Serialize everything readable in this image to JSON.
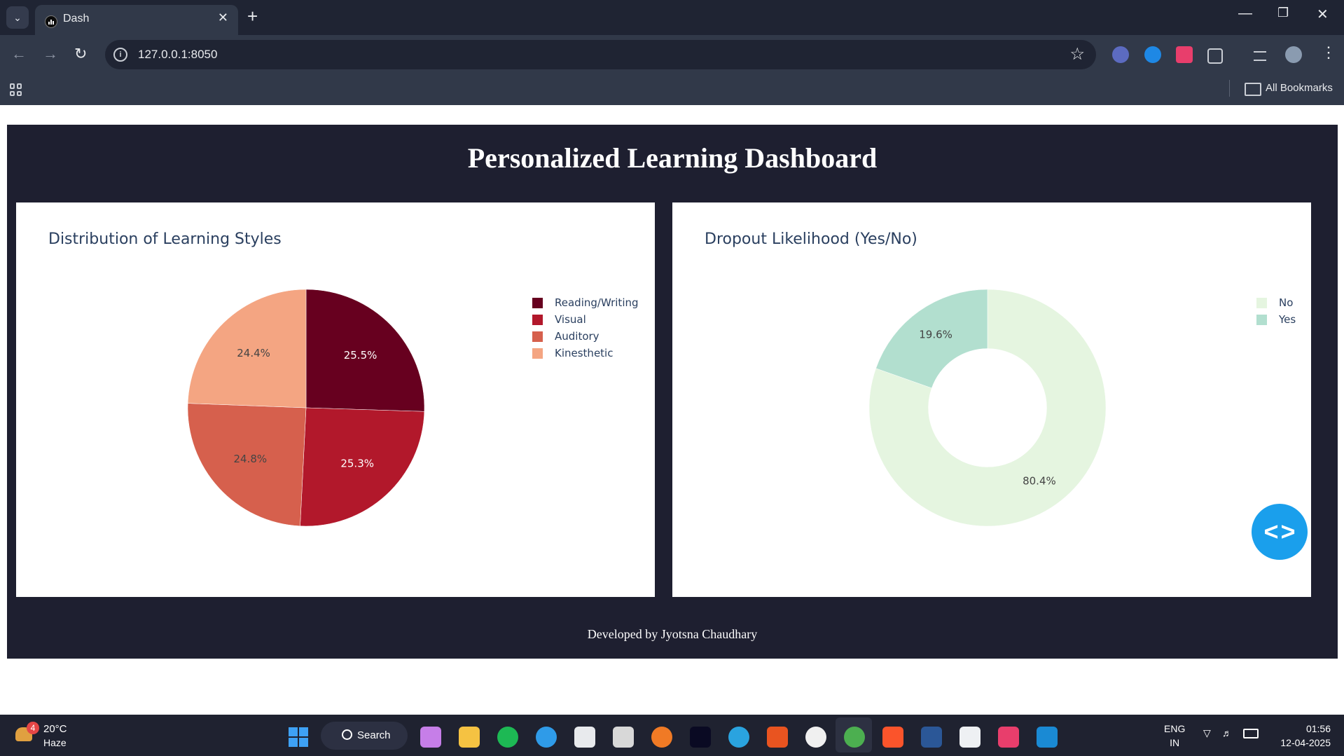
{
  "browser": {
    "tab_title": "Dash",
    "url": "127.0.0.1:8050",
    "bookmarks_label": "All Bookmarks"
  },
  "page": {
    "title": "Personalized Learning Dashboard",
    "footer": "Developed by Jyotsna Chaudhary"
  },
  "chart_data": [
    {
      "type": "pie",
      "title": "Distribution of Learning Styles",
      "labels": [
        "Reading/Writing",
        "Visual",
        "Auditory",
        "Kinesthetic"
      ],
      "values": [
        25.5,
        25.3,
        24.8,
        24.4
      ],
      "text_labels": [
        "25.5%",
        "25.3%",
        "24.8%",
        "24.4%"
      ],
      "colors": [
        "#67001f",
        "#b2182b",
        "#d6604d",
        "#f4a582"
      ],
      "text_colors": [
        "#ffffff",
        "#ffffff",
        "#444444",
        "#444444"
      ],
      "legend": "top-right"
    },
    {
      "type": "pie",
      "hole": 0.5,
      "title": "Dropout Likelihood (Yes/No)",
      "labels": [
        "No",
        "Yes"
      ],
      "values": [
        80.4,
        19.6
      ],
      "text_labels": [
        "80.4%",
        "19.6%"
      ],
      "colors": [
        "#e5f5e0",
        "#b2dfcf"
      ],
      "text_colors": [
        "#444444",
        "#444444"
      ],
      "legend": "top-right"
    }
  ],
  "taskbar": {
    "weather_temp": "20°C",
    "weather_cond": "Haze",
    "weather_badge": "4",
    "search_label": "Search",
    "lang_line1": "ENG",
    "lang_line2": "IN",
    "time": "01:56",
    "date": "12-04-2025"
  },
  "colors": {
    "page_bg": "#1e1f30",
    "fab": "#1a9fec",
    "title_text": "#2a3f5f"
  }
}
